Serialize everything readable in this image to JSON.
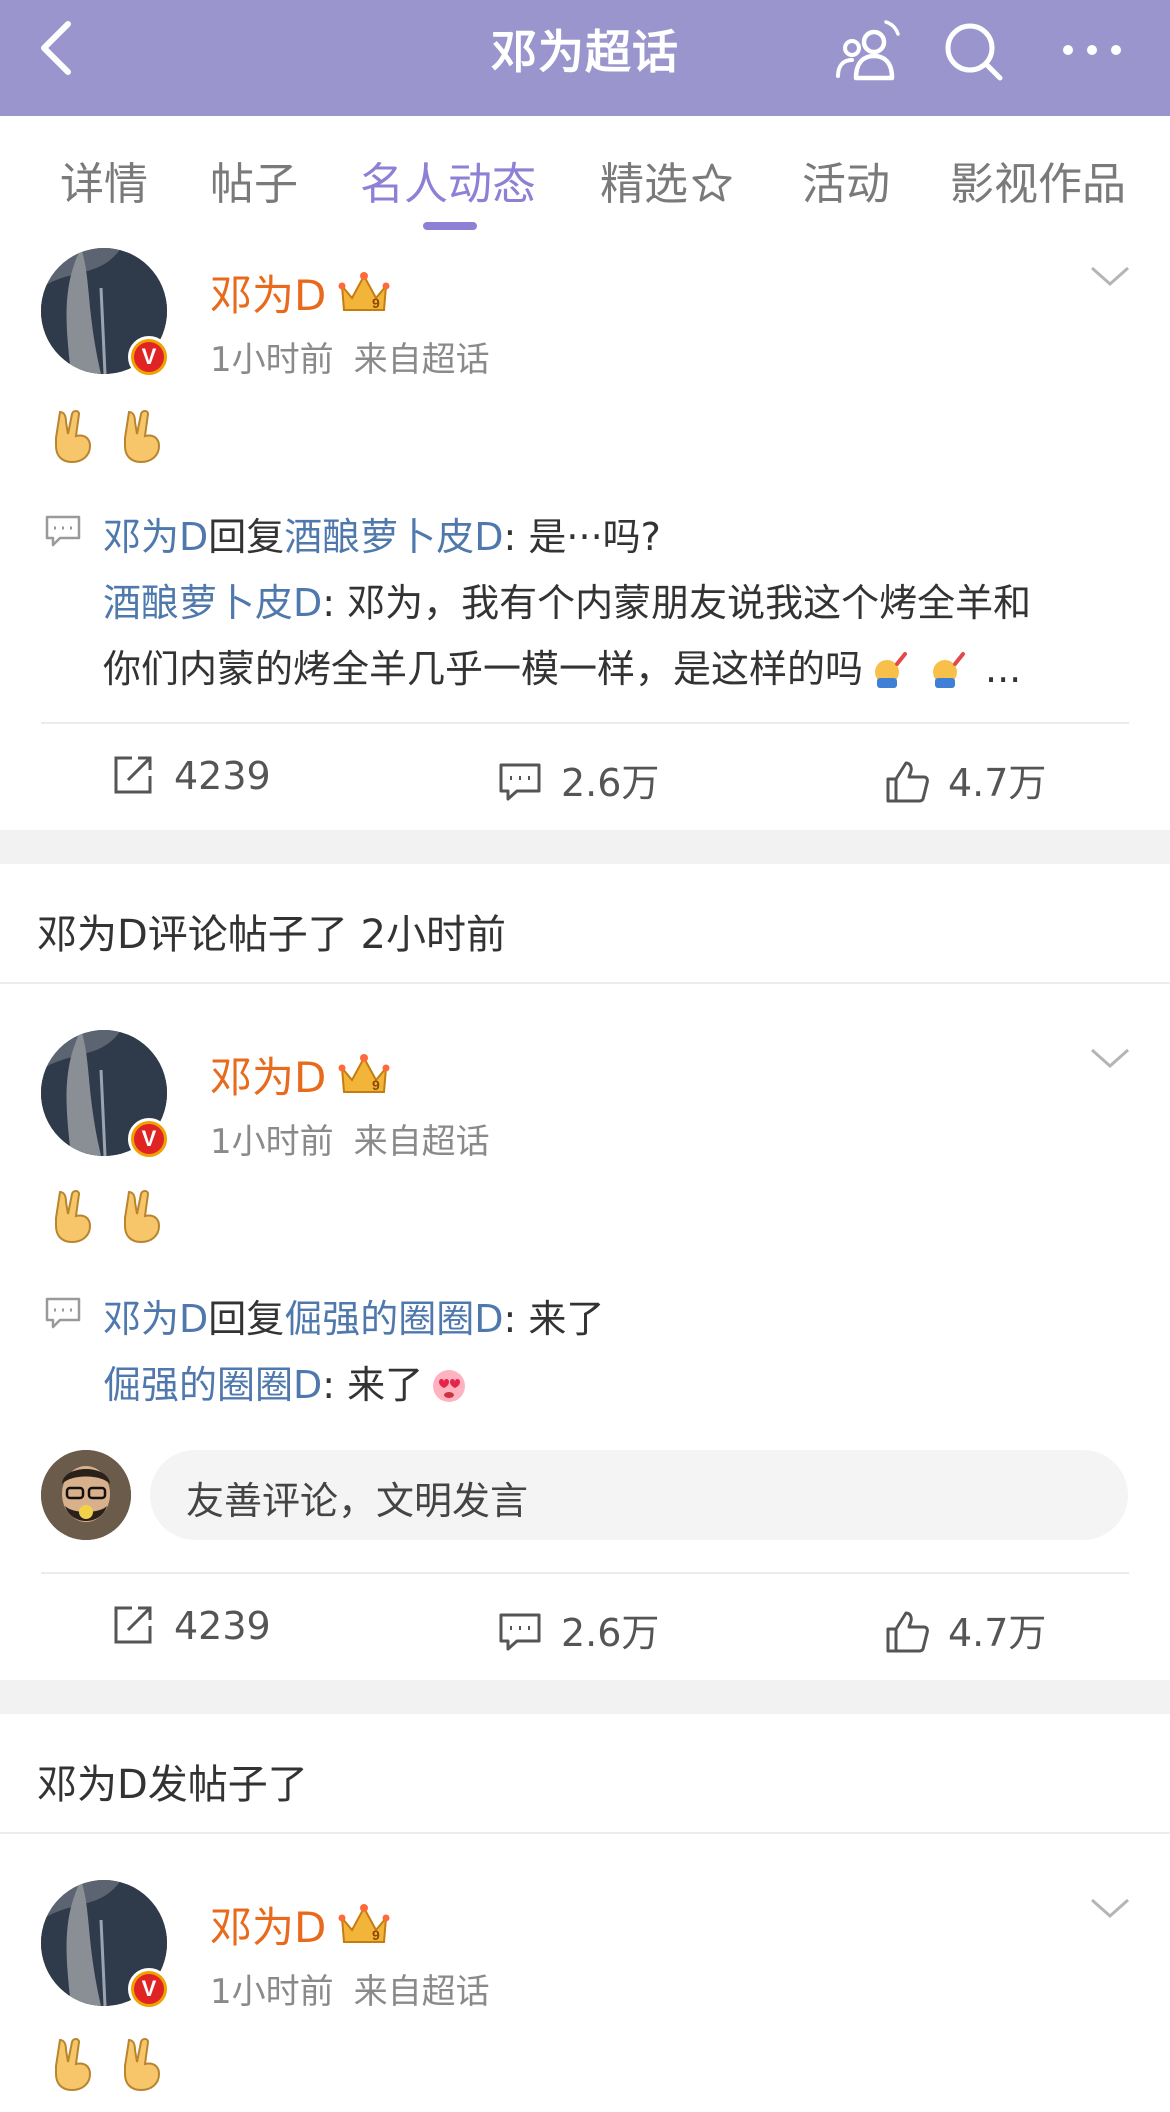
{
  "header": {
    "title": "邓为超话",
    "back_icon": "chevron-left-icon",
    "actions": [
      "people-icon",
      "search-icon",
      "more-icon"
    ],
    "background": "#9a95cd"
  },
  "tabs": {
    "items": [
      {
        "label": "详情"
      },
      {
        "label": "帖子"
      },
      {
        "label": "名人动态"
      },
      {
        "label": "精选"
      },
      {
        "label": "活动"
      },
      {
        "label": "影视作品"
      }
    ],
    "active_index": 2,
    "accent": "#8f80d6"
  },
  "posts": [
    {
      "author": "邓为D",
      "time": "1小时前",
      "source": "来自超话",
      "reply": {
        "author": "邓为D",
        "verb": "回复",
        "target": "酒酿萝卜皮D",
        "text": ": 是···吗?"
      },
      "quoted": {
        "author": "酒酿萝卜皮D",
        "text_line1": ": 邓为，我有个内蒙朋友说我这个烤全羊和",
        "text_line2": "你们内蒙的烤全羊几乎一模一样，是这样的吗",
        "ellipsis": "..."
      },
      "stats": {
        "reposts": "4239",
        "comments": "2.6万",
        "likes": "4.7万"
      }
    },
    {
      "activity": "邓为D评论帖子了 2小时前",
      "author": "邓为D",
      "time": "1小时前",
      "source": "来自超话",
      "reply": {
        "author": "邓为D",
        "verb": "回复",
        "target": "倔强的圈圈D",
        "text": ": 来了"
      },
      "quoted": {
        "author": "倔强的圈圈D",
        "text_line1": ": 来了"
      },
      "comment_placeholder": "友善评论，文明发言",
      "stats": {
        "reposts": "4239",
        "comments": "2.6万",
        "likes": "4.7万"
      }
    },
    {
      "activity": "邓为D发帖子了",
      "author": "邓为D",
      "time": "1小时前",
      "source": "来自超话"
    }
  ],
  "colors": {
    "username": "#e86a1d",
    "mention": "#4f78ad",
    "verified_badge": "#f0a000"
  }
}
